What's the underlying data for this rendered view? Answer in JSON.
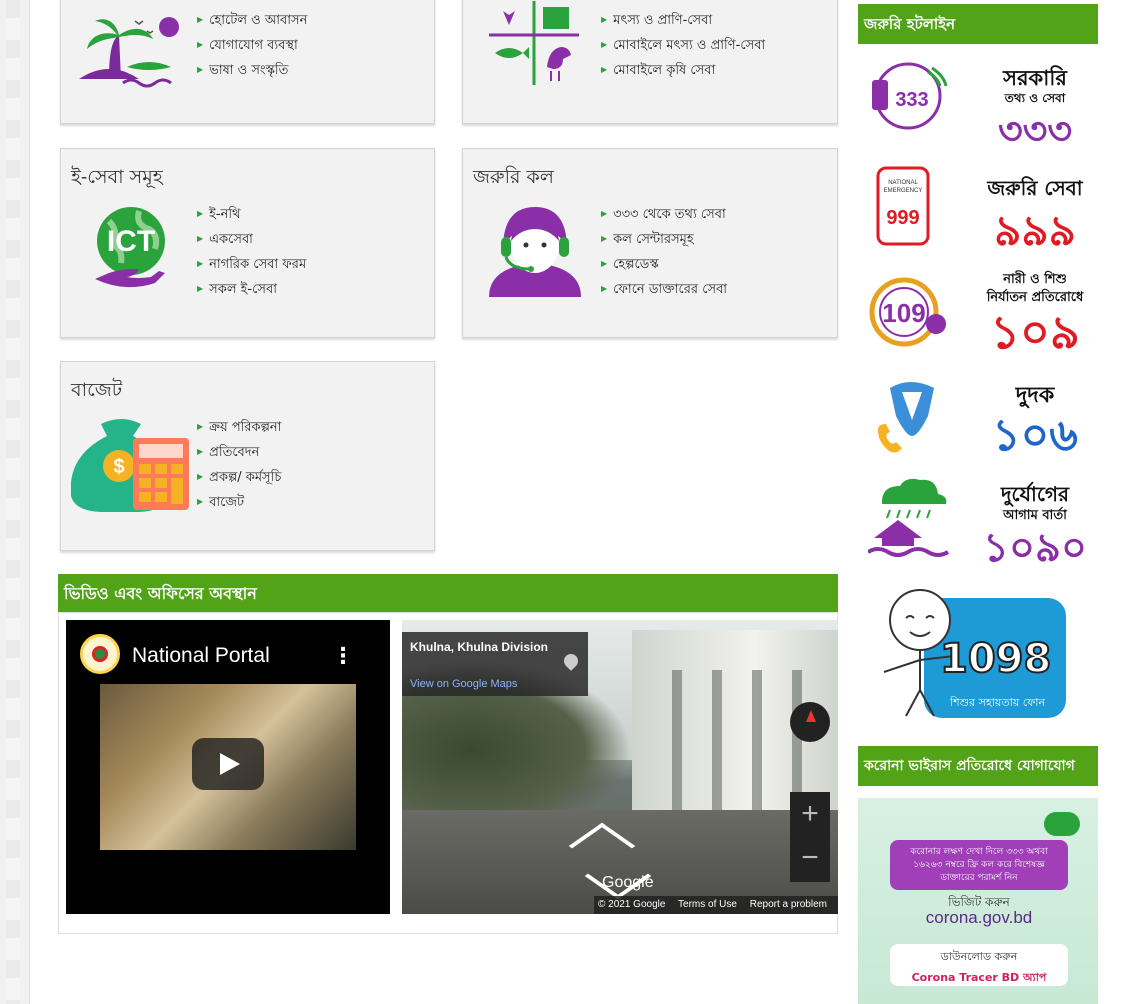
{
  "cards": [
    {
      "id": "tourism",
      "title": "",
      "links": [
        "হোটেল ও আবাসন",
        "যোগাযোগ ব্যবস্থা",
        "ভাষা ও সংস্কৃতি"
      ]
    },
    {
      "id": "agri",
      "title": "",
      "links": [
        "মৎস্য ও প্রাণি-সেবা",
        "মোবাইলে মৎস্য ও প্রাণি-সেবা",
        "মোবাইলে কৃষি সেবা"
      ]
    },
    {
      "id": "eservice",
      "title": "ই-সেবা সমূহ",
      "links": [
        "ই-নথি",
        "একসেবা",
        "নাগরিক সেবা ফরম",
        "সকল ই-সেবা"
      ]
    },
    {
      "id": "emergency-call",
      "title": "জরুরি কল",
      "links": [
        "৩৩৩ থেকে তথ্য সেবা",
        "কল সেন্টারসমূহ",
        "হেল্পডেস্ক",
        "ফোনে ডাক্তারের সেবা"
      ]
    },
    {
      "id": "budget",
      "title": "বাজেট",
      "links": [
        "ক্রয় পরিকল্পনা",
        "প্রতিবেদন",
        "প্রকল্প/ কর্মসূচি",
        "বাজেট"
      ]
    }
  ],
  "icons": {
    "ict_text": "ICT"
  },
  "video_section": {
    "heading": "ভিডিও এবং অফিসের অবস্থান",
    "video_title": "National Portal",
    "video_menu": "⋮",
    "map_location": "Khulna, Khulna Division",
    "map_link": "View on Google Maps",
    "map_brand": "Google",
    "map_zoom_in": "+",
    "map_zoom_out": "−",
    "map_footer": [
      "© 2021 Google",
      "Terms of Use",
      "Report a problem"
    ]
  },
  "sidebar": {
    "hotline_heading": "জরুরি হটলাইন",
    "hotlines": [
      {
        "label1": "সরকারি",
        "label2": "তথ্য ও সেবা",
        "number": "৩৩৩",
        "badge": "333",
        "color": "#8a2fa8"
      },
      {
        "label1": "জরুরি সেবা",
        "label2": "",
        "number": "৯৯৯",
        "badge": "999",
        "color": "#e01b24"
      },
      {
        "label1": "নারী ও শিশু",
        "label2": "নির্যাতন প্রতিরোধে",
        "number": "১০৯",
        "badge": "109",
        "color": "#e01b24"
      },
      {
        "label1": "দুদক",
        "label2": "",
        "number": "১০৬",
        "badge": "",
        "color": "#1e66c8"
      },
      {
        "label1": "দুর্যোগের",
        "label2": "আগাম বার্তা",
        "number": "১০৯০",
        "badge": "",
        "color": "#8a2fa8"
      }
    ],
    "child_helpline": {
      "number": "1098",
      "caption": "শিশুর সহায়তায় ফোন"
    },
    "corona_heading": "করোনা ভাইরাস প্রতিরোধে যোগাযোগ",
    "corona": {
      "notice": "করোনার লক্ষণ দেখা দিলে ৩৩৩ অথবা ১৬২৬৩ নম্বরে ফ্রি কল করে বিশেষজ্ঞ ডাক্তারের পরামর্শ নিন",
      "visit": "ভিজিট করুন",
      "site": "corona.gov.bd",
      "download": "ডাউনলোড করুন",
      "app": "Corona Tracer BD অ্যাপ"
    }
  },
  "colors": {
    "green": "#53a318",
    "purple": "#8a2fa8",
    "red": "#e01b24",
    "blue": "#1e66c8"
  }
}
